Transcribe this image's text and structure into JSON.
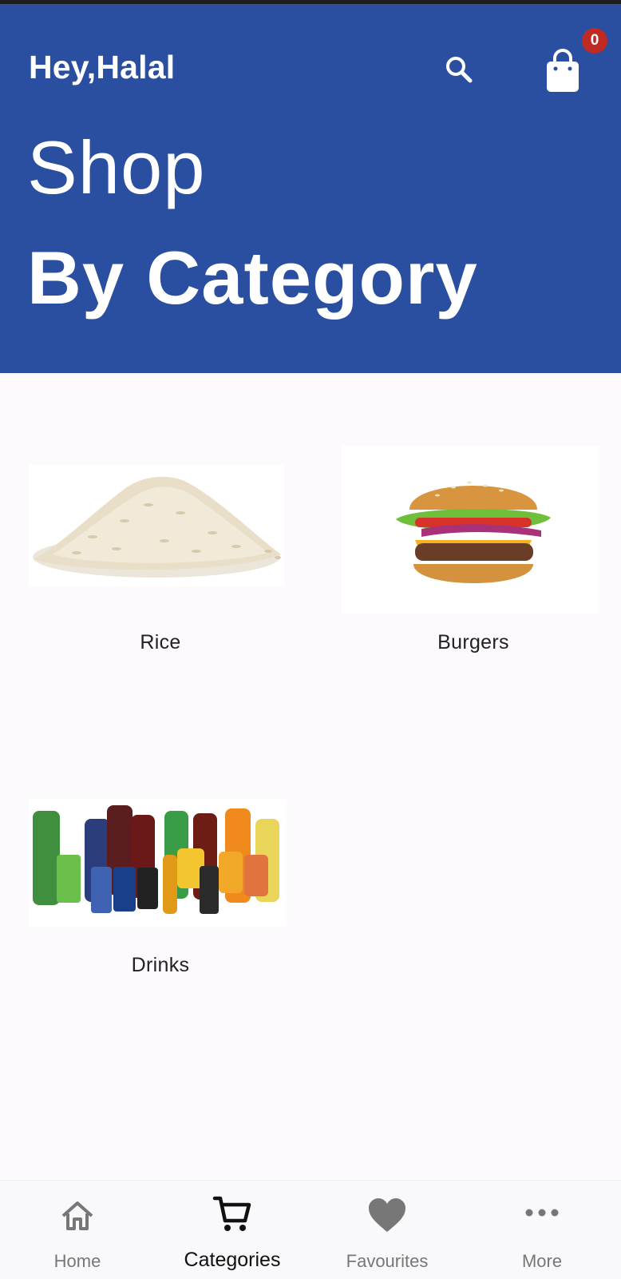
{
  "header": {
    "greeting": "Hey,Halal",
    "title_line1": "Shop",
    "title_line2": "By Category",
    "cart_count": "0",
    "background_color": "#2a4ea0",
    "badge_color": "#bf2b22"
  },
  "categories": [
    {
      "label": "Rice",
      "icon": "rice-image"
    },
    {
      "label": "Burgers",
      "icon": "burger-image"
    },
    {
      "label": "Drinks",
      "icon": "drinks-image"
    }
  ],
  "bottom_nav": {
    "items": [
      {
        "label": "Home",
        "icon": "home-icon",
        "active": false
      },
      {
        "label": "Categories",
        "icon": "cart-icon",
        "active": true
      },
      {
        "label": "Favourites",
        "icon": "heart-icon",
        "active": false
      },
      {
        "label": "More",
        "icon": "more-icon",
        "active": false
      }
    ]
  }
}
